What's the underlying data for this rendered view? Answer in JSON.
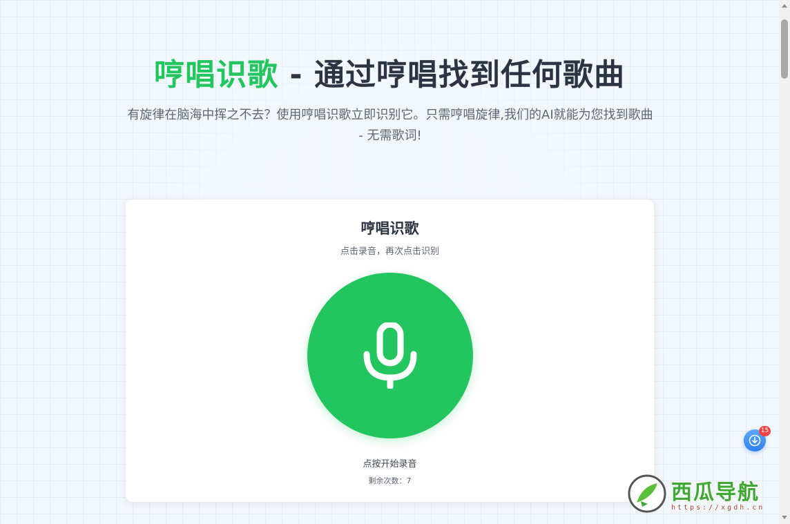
{
  "hero": {
    "title_accent": "哼唱识歌",
    "title_rest": " - 通过哼唱找到任何歌曲",
    "subtitle": "有旋律在脑海中挥之不去？使用哼唱识歌立即识别它。只需哼唱旋律,我们的AI就能为您找到歌曲 - 无需歌词!"
  },
  "card": {
    "title": "哼唱识歌",
    "hint": "点击录音，再次点击识别",
    "mic_icon": "microphone-icon",
    "record_label": "点按开始录音",
    "remaining": "剩余次数：7"
  },
  "floating": {
    "icon": "download-icon",
    "badge": "15"
  },
  "watermark": {
    "name": "西瓜导航",
    "url": "https://xgdh.cn"
  },
  "colors": {
    "accent": "#22c55e",
    "text_dark": "#2a3442",
    "badge": "#ef4444"
  }
}
